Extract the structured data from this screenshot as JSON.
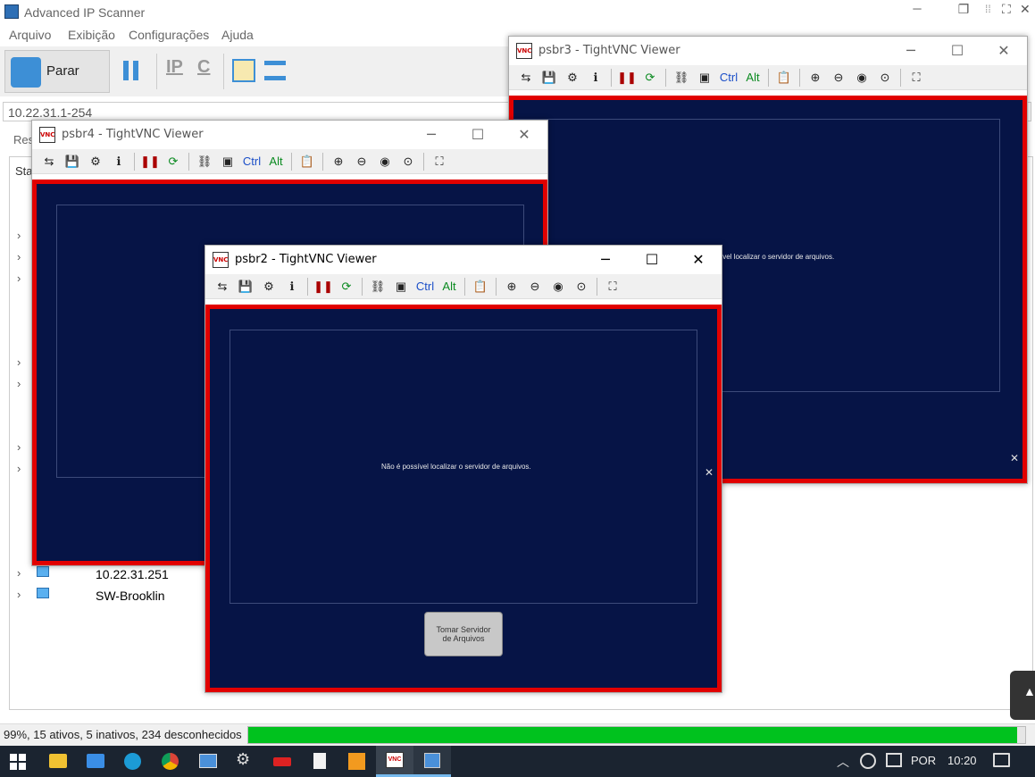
{
  "main": {
    "title": "Advanced IP Scanner",
    "menu": [
      "Arquivo",
      "Exibição",
      "Configurações",
      "Ajuda"
    ],
    "stop_label": "Parar",
    "tb_ip": "IP",
    "tb_c": "C",
    "ip_range": "10.22.31.1-254",
    "tab_res": "Res",
    "col_status": "Sta",
    "rows": [
      "10.22.31.251",
      "SW-Brooklin"
    ],
    "status_text": "99%, 15 ativos, 5 inativos, 234 desconhecidos",
    "progress": 0.99
  },
  "vnc_windows": [
    {
      "title": "psbr3 - TightVNC Viewer",
      "message": "sível localizar o servidor de arquivos."
    },
    {
      "title": "psbr4 - TightVNC Viewer"
    },
    {
      "title": "psbr2 - TightVNC Viewer",
      "message": "Não é possível localizar o servidor de arquivos.",
      "button": "Tomar Servidor de Arquivos"
    }
  ],
  "toolbar": {
    "ctrl": "Ctrl",
    "alt": "Alt"
  },
  "taskbar": {
    "language": "POR",
    "time": "10:20"
  },
  "colors": {
    "vnc_bg": "#061446",
    "vnc_border": "#e10000",
    "progress": "#00c21e"
  },
  "icons": [
    "windows-start-icon",
    "file-explorer-icon",
    "edge-icon",
    "chrome-icon",
    "settings-icon",
    "vnc-icon",
    "ip-scanner-icon",
    "notification-icon"
  ]
}
